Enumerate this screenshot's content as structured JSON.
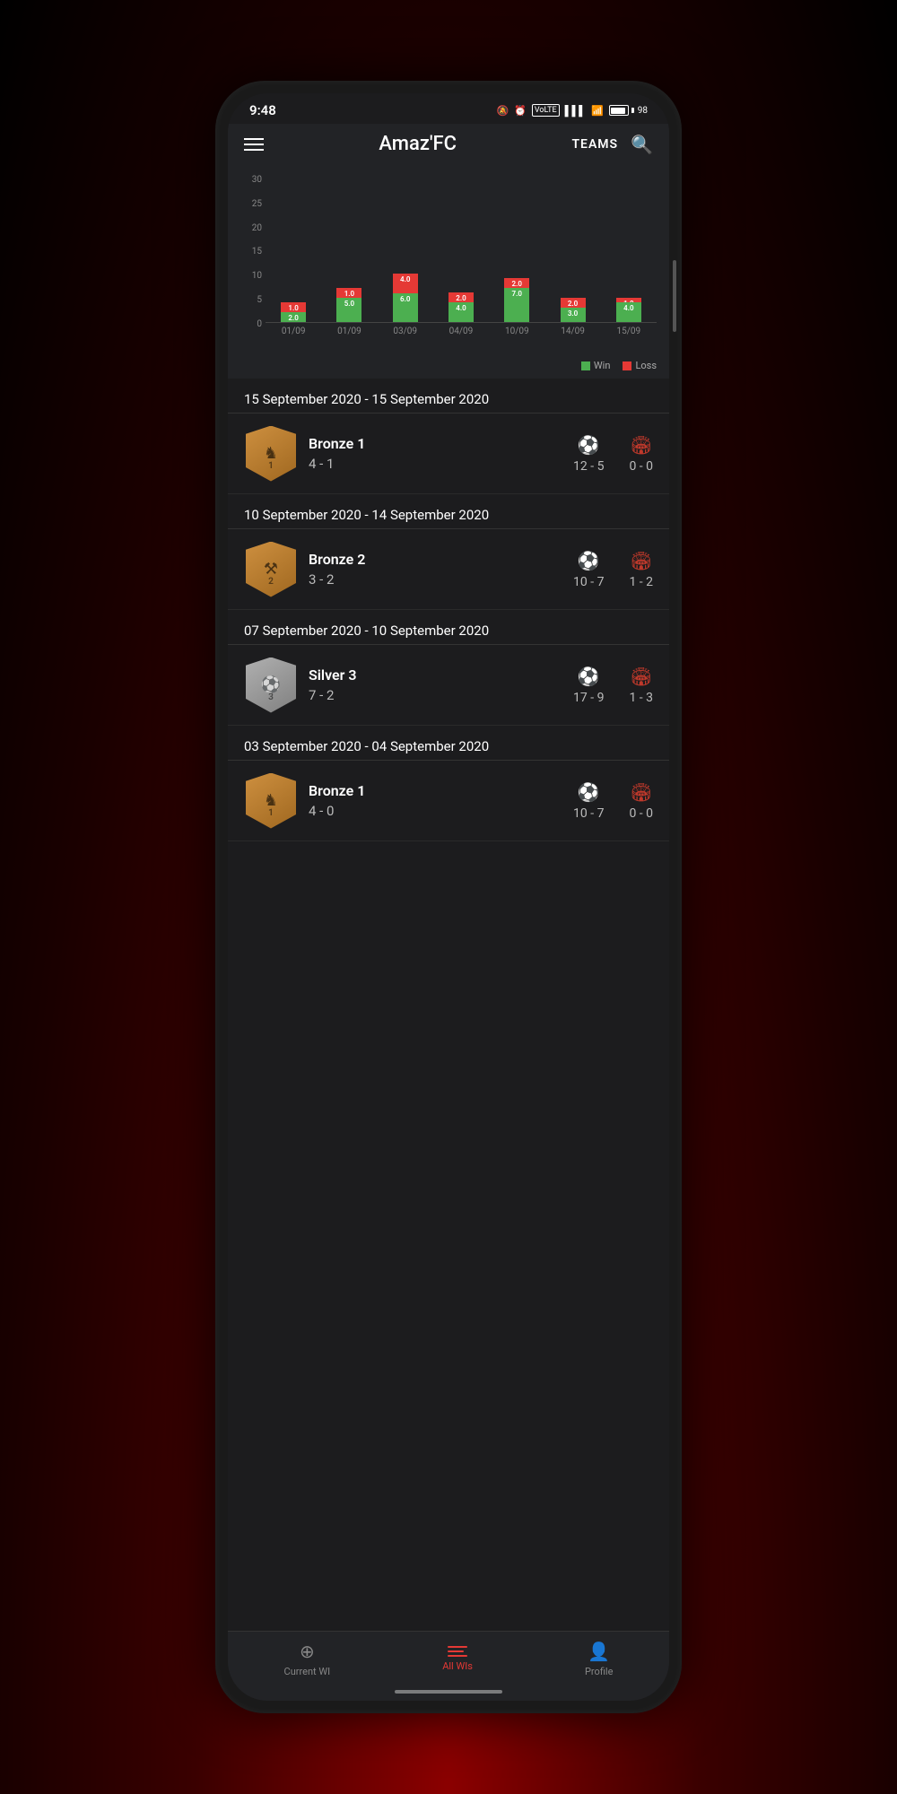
{
  "statusBar": {
    "time": "9:48",
    "battery": "98"
  },
  "header": {
    "title": "Amaz'FC",
    "teamsLabel": "TEAMS",
    "menuIcon": "menu-icon",
    "searchIcon": "search-icon"
  },
  "chart": {
    "yLabels": [
      "30",
      "25",
      "20",
      "15",
      "10",
      "5",
      "0"
    ],
    "bars": [
      {
        "date": "01/09",
        "redVal": 2.0,
        "greenVal": 1.0,
        "redH": 11,
        "greenH": 5
      },
      {
        "date": "01/09",
        "redVal": 5.0,
        "greenVal": 1.0,
        "redH": 27,
        "greenH": 5
      },
      {
        "date": "03/09",
        "redVal": 6.0,
        "greenVal": 4.0,
        "redH": 32,
        "greenH": 22
      },
      {
        "date": "04/09",
        "redVal": 4.0,
        "greenVal": 2.0,
        "redH": 22,
        "greenH": 11
      },
      {
        "date": "10/09",
        "redVal": 7.0,
        "greenVal": 2.0,
        "redH": 38,
        "greenH": 11
      },
      {
        "date": "14/09",
        "redVal": 3.0,
        "greenVal": 2.0,
        "redH": 16,
        "greenH": 11
      },
      {
        "date": "15/09",
        "redVal": 4.0,
        "greenVal": 1.0,
        "redH": 22,
        "greenH": 5
      }
    ],
    "legend": {
      "win": "Win",
      "loss": "Loss"
    }
  },
  "sections": [
    {
      "dateRange": "15 September 2020 - 15 September 2020",
      "tier": "Bronze 1",
      "score": "4 - 1",
      "badgeType": "bronze",
      "badgeNumber": "1",
      "soccerScore": "12 - 5",
      "trophyScore": "0 - 0"
    },
    {
      "dateRange": "10 September 2020 - 14 September 2020",
      "tier": "Bronze 2",
      "score": "3 - 2",
      "badgeType": "bronze",
      "badgeNumber": "2",
      "soccerScore": "10 - 7",
      "trophyScore": "1 - 2"
    },
    {
      "dateRange": "07 September 2020 - 10 September 2020",
      "tier": "Silver 3",
      "score": "7 - 2",
      "badgeType": "silver",
      "badgeNumber": "3",
      "soccerScore": "17 - 9",
      "trophyScore": "1 - 3"
    },
    {
      "dateRange": "03 September 2020 - 04 September 2020",
      "tier": "Bronze 1",
      "score": "4 - 0",
      "badgeType": "bronze",
      "badgeNumber": "1",
      "soccerScore": "10 - 7",
      "trophyScore": "0 - 0"
    }
  ],
  "bottomNav": {
    "currentWI": "Current WI",
    "allWIs": "All WIs",
    "profile": "Profile"
  }
}
